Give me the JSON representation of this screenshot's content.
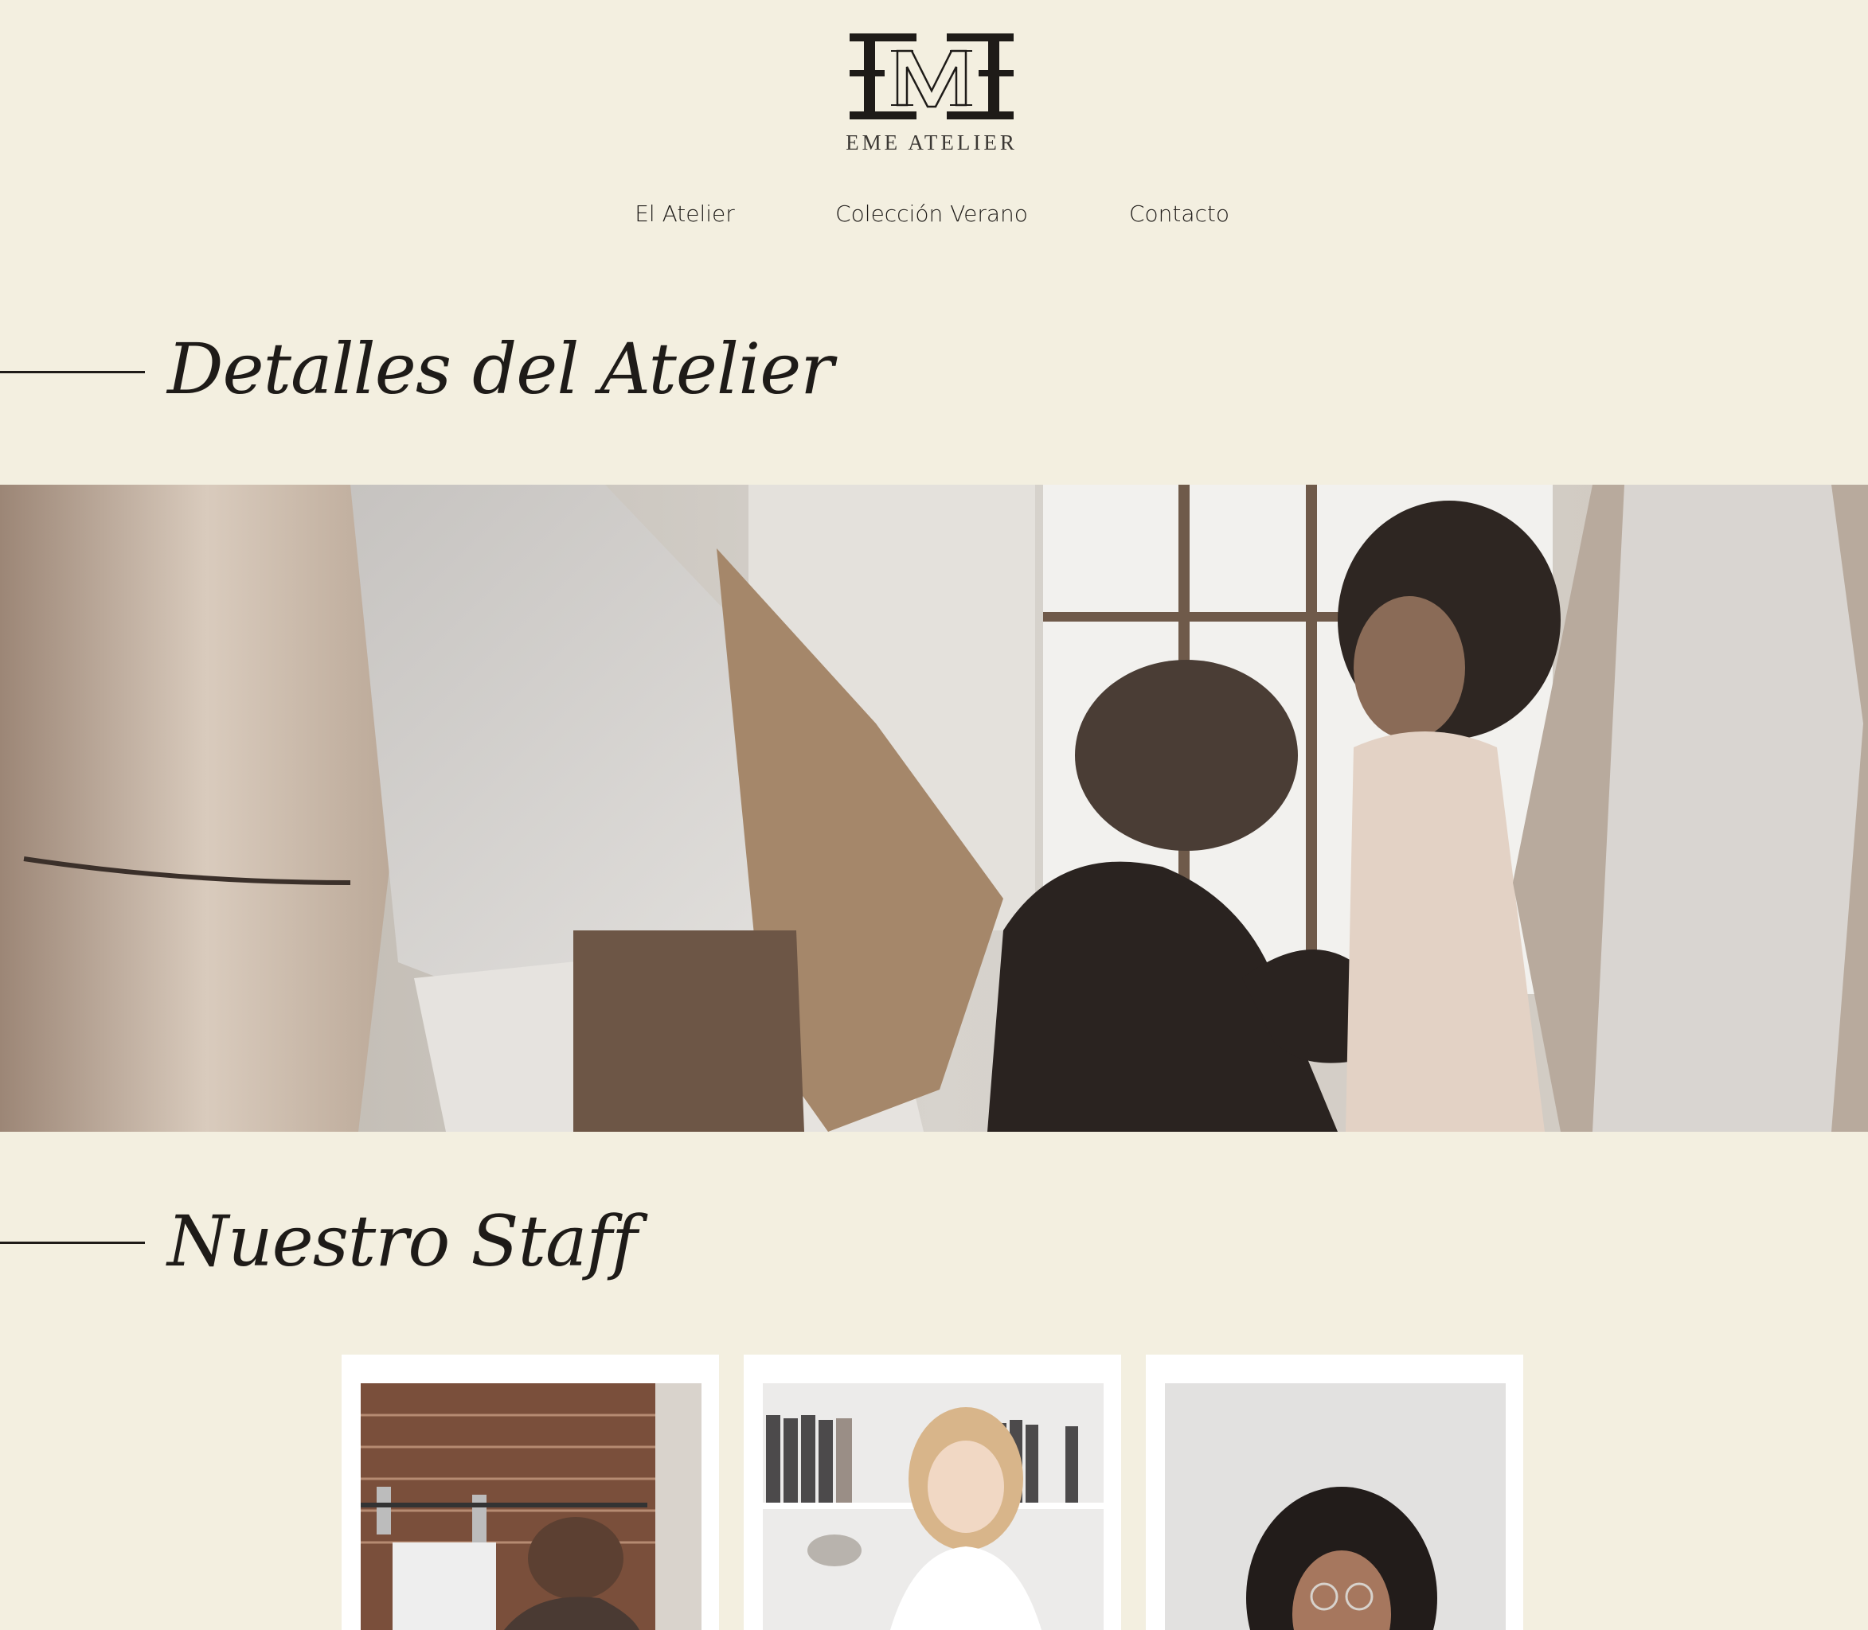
{
  "brand": {
    "monogram": "EME",
    "name": "EME ATELIER"
  },
  "nav": {
    "items": [
      {
        "label": "El Atelier"
      },
      {
        "label": "Colección Verano"
      },
      {
        "label": "Contacto"
      }
    ]
  },
  "sections": {
    "details_title": "Detalles del Atelier",
    "staff_title": "Nuestro Staff"
  },
  "hero": {
    "image": "atelier-fitting-photo"
  },
  "staff": {
    "cards": [
      {
        "image": "staff-photo-1"
      },
      {
        "image": "staff-photo-2"
      },
      {
        "image": "staff-photo-3"
      }
    ]
  },
  "colors": {
    "background": "#f3efe0",
    "text": "#1e1b18",
    "card": "#ffffff"
  }
}
